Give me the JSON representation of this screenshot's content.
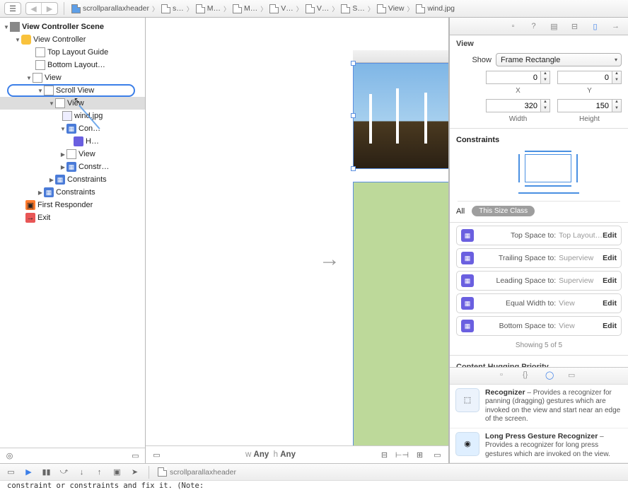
{
  "breadcrumb": [
    "scrollparallaxheader",
    "s…",
    "M…",
    "M…",
    "V…",
    "V…",
    "S…",
    "View",
    "wind.jpg"
  ],
  "outline": {
    "scene": "View Controller Scene",
    "vc": "View Controller",
    "topGuide": "Top Layout Guide",
    "bottomGuide": "Bottom Layout…",
    "view": "View",
    "scrollView": "Scroll View",
    "view2": "View",
    "windjpg": "wind.jpg",
    "con": "Con…",
    "h": "H…",
    "view3": "View",
    "constr": "Constr…",
    "constraints1": "Constraints",
    "constraints2": "Constraints",
    "first": "First Responder",
    "exit": "Exit"
  },
  "inspector": {
    "headerView": "View",
    "show": "Show",
    "showValue": "Frame Rectangle",
    "x": "0",
    "y": "0",
    "xLabel": "X",
    "yLabel": "Y",
    "w": "320",
    "h": "150",
    "wLabel": "Width",
    "hLabel": "Height",
    "constraintsHeader": "Constraints",
    "filterAll": "All",
    "filterClass": "This Size Class",
    "rows": [
      {
        "label": "Top Space to:",
        "val": "Top Layout…",
        "edit": "Edit"
      },
      {
        "label": "Trailing Space to:",
        "val": "Superview",
        "edit": "Edit"
      },
      {
        "label": "Leading Space to:",
        "val": "Superview",
        "edit": "Edit"
      },
      {
        "label": "Equal Width to:",
        "val": "View",
        "edit": "Edit"
      },
      {
        "label": "Bottom Space to:",
        "val": "View",
        "edit": "Edit"
      }
    ],
    "showing": "Showing 5 of 5",
    "hugging": "Content Hugging Priority"
  },
  "library": [
    {
      "title": "Recognizer",
      "desc": " – Provides a recognizer for panning (dragging) gestures which are invoked on the view and start near an edge of the screen."
    },
    {
      "title": "Long Press Gesture Recognizer",
      "desc": " – Provides a recognizer for long press gestures which are invoked on the view."
    }
  ],
  "centerFooter": {
    "size": "w Any  h Any"
  },
  "jumpbar": "scrollparallaxheader",
  "console": "constraint or constraints and fix it. (Note:"
}
